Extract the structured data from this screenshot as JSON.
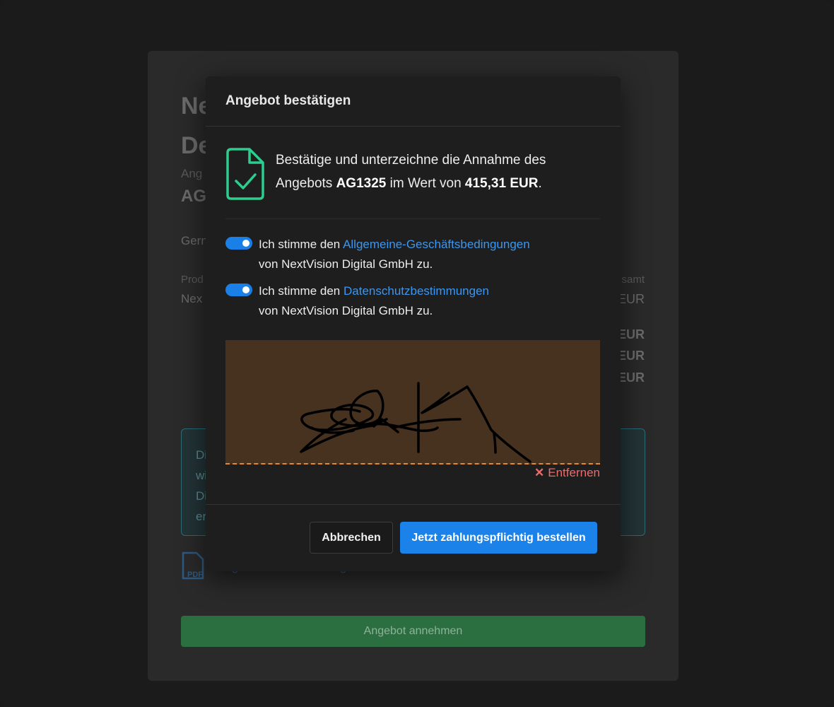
{
  "background": {
    "title_line1": "Ne",
    "title_line2": "De",
    "offer_label": "Ang",
    "offer_number": "AG",
    "greeting": "Gern",
    "col_product": "Prod",
    "product_name": "Nex",
    "col_total": "samt",
    "eur_values": [
      "EUR",
      "EUR",
      "EUR",
      "EUR"
    ],
    "info_lines": [
      "Di",
      "wi",
      "Di",
      "er"
    ],
    "pdf_icon_label": "PDF",
    "pdf_link": "Angebot als PDF anzeigen",
    "accept_button": "Angebot annehmen"
  },
  "modal": {
    "title": "Angebot bestätigen",
    "summary": {
      "prefix": "Bestätige und unterzeichne die Annahme des Angebots ",
      "offer_id": "AG1325",
      "middle": " im Wert von ",
      "amount": "415,31 EUR",
      "suffix": "."
    },
    "consents": [
      {
        "checked": true,
        "prefix": "Ich stimme den ",
        "link": "Allgemeine-Geschäftsbedingungen",
        "suffix": "von NextVision Digital GmbH zu."
      },
      {
        "checked": true,
        "prefix": "Ich stimme den ",
        "link": "Datenschutzbestimmungen",
        "suffix": "von NextVision Digital GmbH zu."
      }
    ],
    "signature": {
      "remove_icon": "✕",
      "remove_label": "Entfernen"
    },
    "footer": {
      "cancel_label": "Abbrechen",
      "order_label": "Jetzt zahlungspflichtig bestellen"
    }
  },
  "colors": {
    "accent_blue": "#1b82ea",
    "success_green": "#2ecc8f",
    "danger_red": "#f06a6a",
    "signature_bg": "#47311f",
    "signature_line": "#e08a34"
  }
}
